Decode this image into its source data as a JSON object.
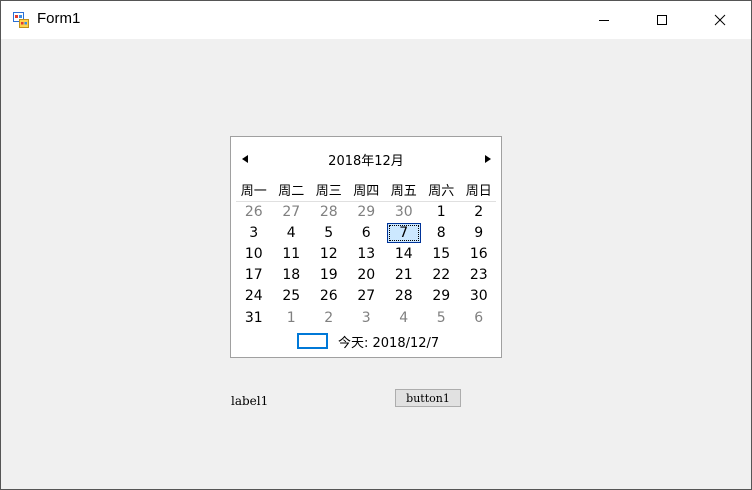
{
  "window": {
    "title": "Form1",
    "icon": "winforms-app-icon",
    "controls": {
      "minimize": "minimize-icon",
      "maximize": "maximize-icon",
      "close": "close-icon"
    }
  },
  "calendar": {
    "month_title": "2018年12月",
    "weekdays": [
      "周一",
      "周二",
      "周三",
      "周四",
      "周五",
      "周六",
      "周日"
    ],
    "weeks": [
      [
        "26",
        "27",
        "28",
        "29",
        "30",
        "1",
        "2"
      ],
      [
        "3",
        "4",
        "5",
        "6",
        "7",
        "8",
        "9"
      ],
      [
        "10",
        "11",
        "12",
        "13",
        "14",
        "15",
        "16"
      ],
      [
        "17",
        "18",
        "19",
        "20",
        "21",
        "22",
        "23"
      ],
      [
        "24",
        "25",
        "26",
        "27",
        "28",
        "29",
        "30"
      ],
      [
        "31",
        "1",
        "2",
        "3",
        "4",
        "5",
        "6"
      ]
    ],
    "selected_day": "7",
    "today_label": "今天: 2018/12/7",
    "colors": {
      "selected_bg": "#cce8ff",
      "selected_border": "#003399",
      "today_box": "#0078d7",
      "other_month": "#808080"
    }
  },
  "label1": {
    "text": "label1"
  },
  "button1": {
    "label": "button1"
  }
}
